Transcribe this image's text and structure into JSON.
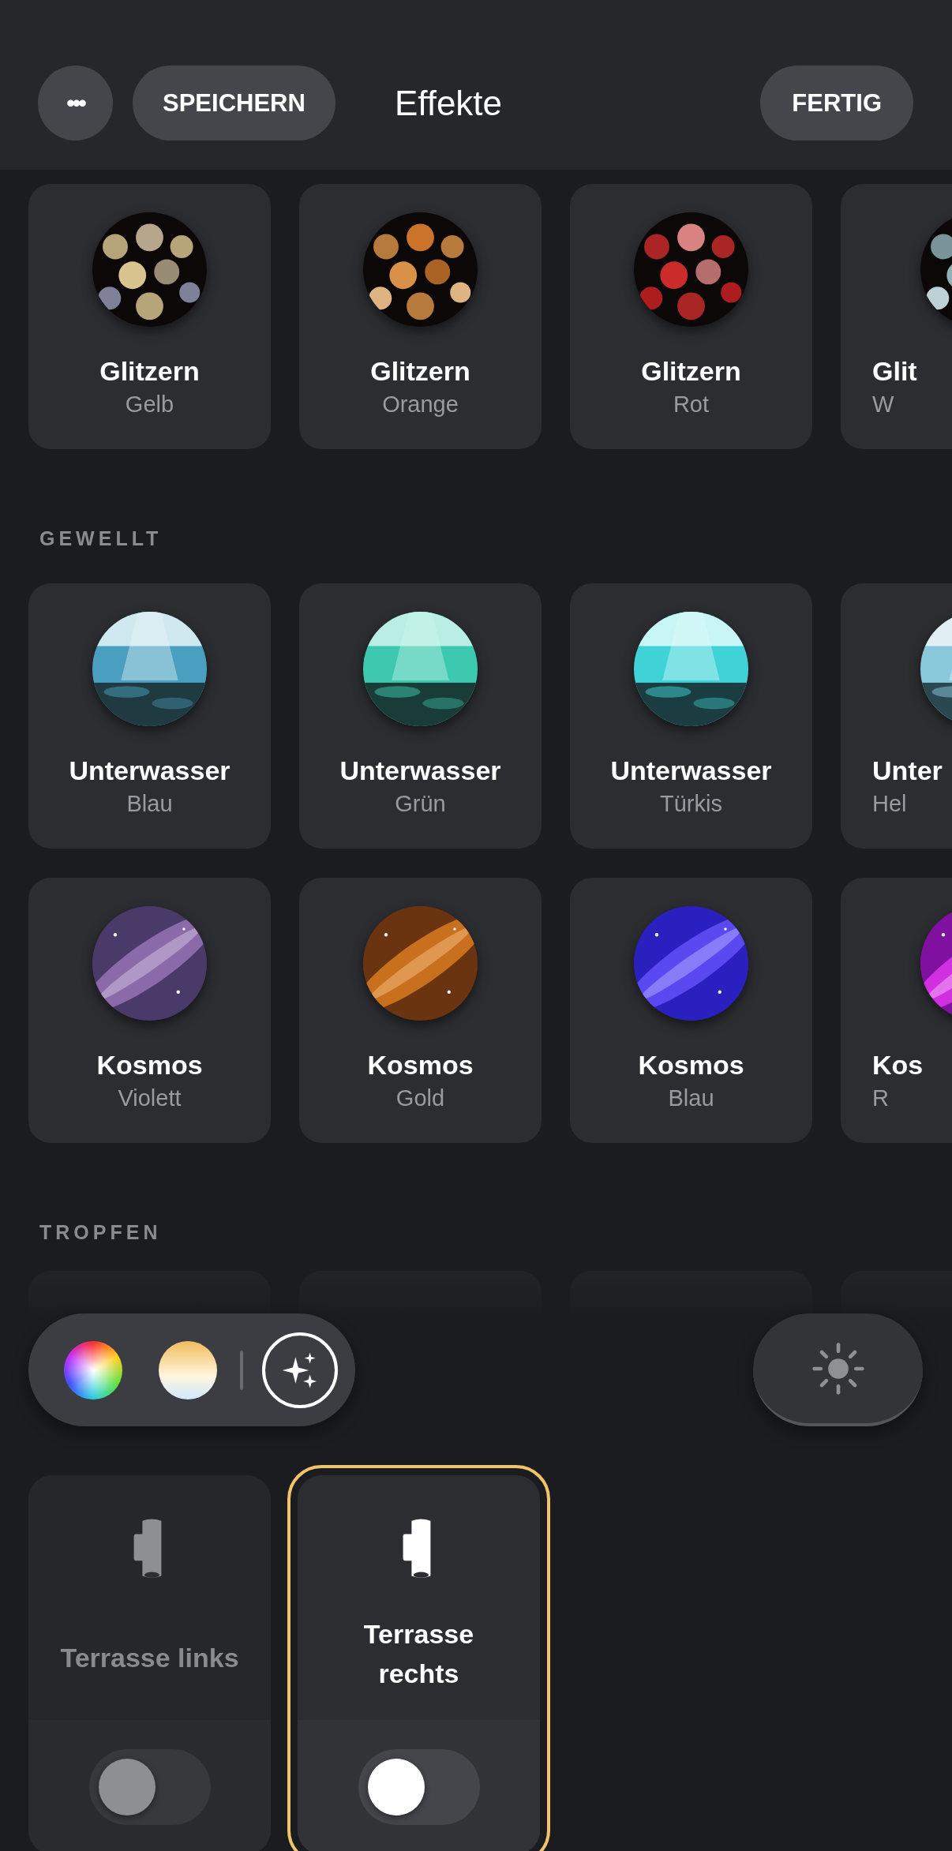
{
  "header": {
    "more_button": "•••",
    "save_button": "SPEICHERN",
    "title": "Effekte",
    "done_button": "FERTIG"
  },
  "sections": [
    {
      "rows": [
        [
          {
            "title": "Glitzern",
            "subtitle": "Gelb"
          },
          {
            "title": "Glitzern",
            "subtitle": "Orange"
          },
          {
            "title": "Glitzern",
            "subtitle": "Rot"
          },
          {
            "title": "Glit",
            "subtitle": "W"
          }
        ]
      ]
    },
    {
      "label": "GEWELLT",
      "rows": [
        [
          {
            "title": "Unterwasser",
            "subtitle": "Blau"
          },
          {
            "title": "Unterwasser",
            "subtitle": "Grün"
          },
          {
            "title": "Unterwasser",
            "subtitle": "Türkis"
          },
          {
            "title": "Unter",
            "subtitle": "Hel"
          }
        ],
        [
          {
            "title": "Kosmos",
            "subtitle": "Violett"
          },
          {
            "title": "Kosmos",
            "subtitle": "Gold"
          },
          {
            "title": "Kosmos",
            "subtitle": "Blau"
          },
          {
            "title": "Kos",
            "subtitle": "R"
          }
        ]
      ]
    },
    {
      "label": "TROPFEN"
    }
  ],
  "toolbar": {
    "modes": [
      {
        "kind": "color",
        "selected": false
      },
      {
        "kind": "white",
        "selected": false
      },
      {
        "kind": "effects",
        "selected": true
      }
    ]
  },
  "devices": [
    {
      "name": "Terrasse links",
      "disabled": true,
      "on": false,
      "selected": false
    },
    {
      "name": "Terrasse rechts",
      "disabled": false,
      "on": false,
      "selected": true
    }
  ]
}
